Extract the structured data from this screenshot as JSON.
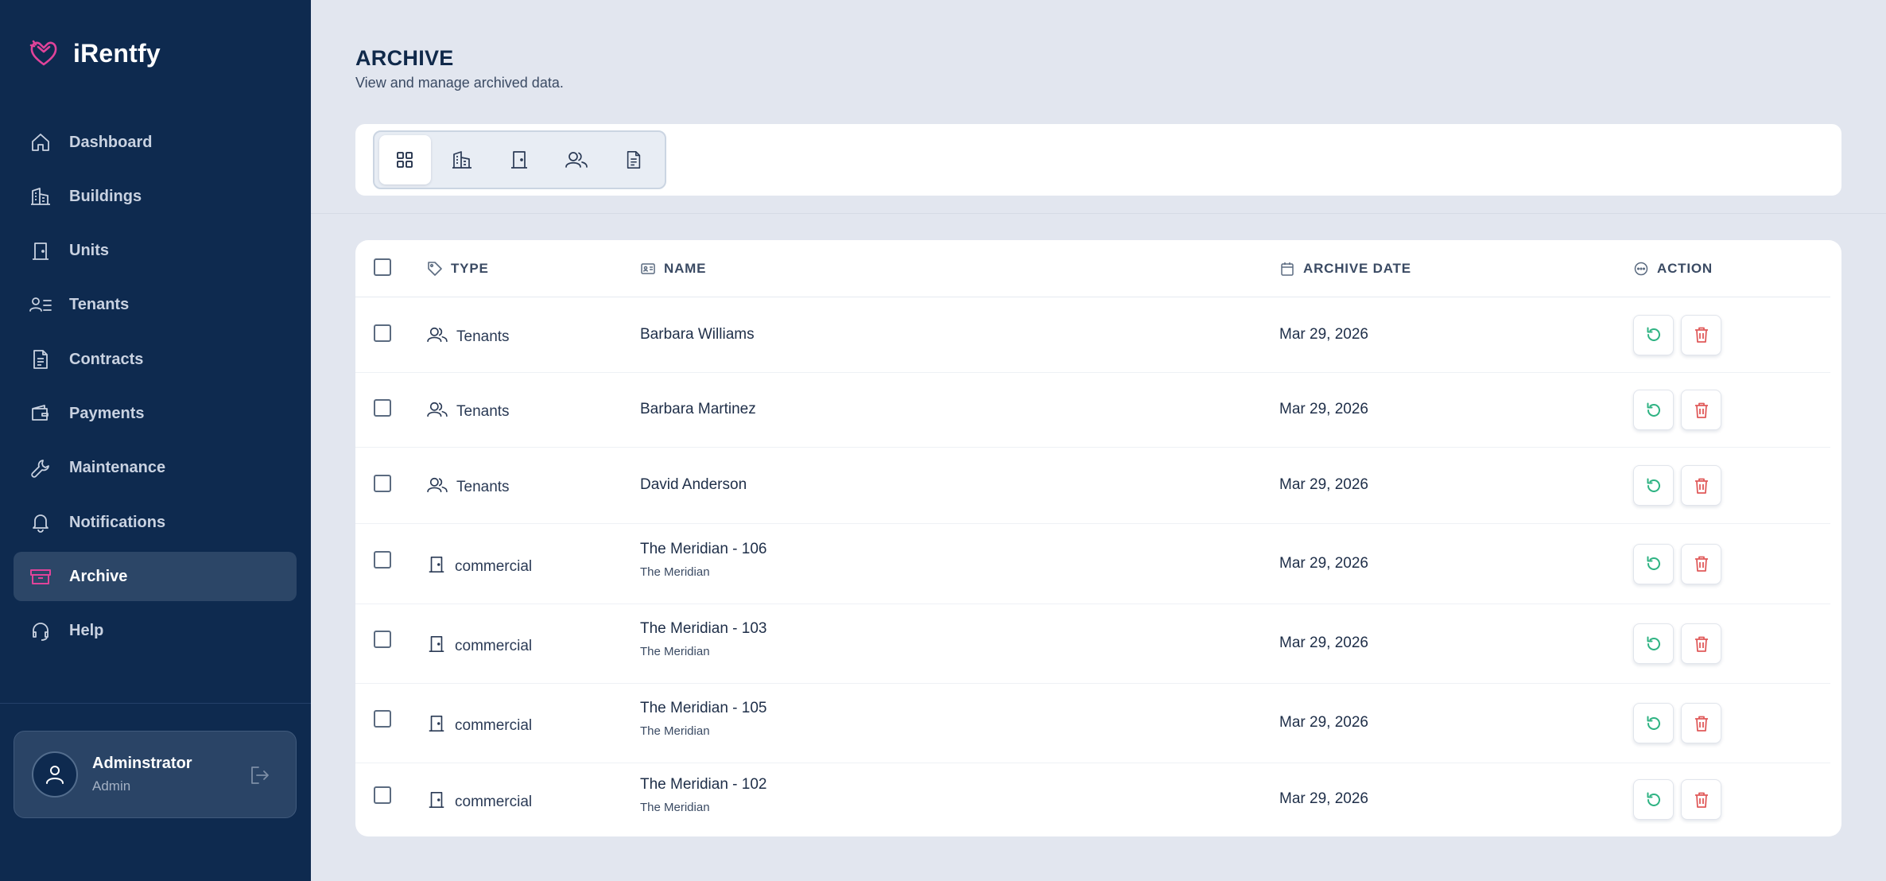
{
  "app": {
    "name": "iRentfy"
  },
  "colors": {
    "sidebar": "#0e2a4f",
    "accent": "#e0439a",
    "restore": "#2fb383",
    "delete": "#e05a5a",
    "background": "#e2e6ef"
  },
  "sidebar": {
    "items": [
      {
        "label": "Dashboard",
        "icon": "home-icon"
      },
      {
        "label": "Buildings",
        "icon": "building-icon"
      },
      {
        "label": "Units",
        "icon": "door-icon"
      },
      {
        "label": "Tenants",
        "icon": "tenants-list-icon"
      },
      {
        "label": "Contracts",
        "icon": "document-icon"
      },
      {
        "label": "Payments",
        "icon": "wallet-icon"
      },
      {
        "label": "Maintenance",
        "icon": "wrench-icon"
      },
      {
        "label": "Notifications",
        "icon": "bell-icon"
      },
      {
        "label": "Archive",
        "icon": "archive-box-icon",
        "active": true
      },
      {
        "label": "Help",
        "icon": "headset-icon"
      }
    ]
  },
  "user": {
    "name": "Adminstrator",
    "role": "Admin"
  },
  "page": {
    "title": "ARCHIVE",
    "subtitle": "View and manage archived data."
  },
  "filters": [
    {
      "icon": "grid-icon",
      "active": true
    },
    {
      "icon": "building-icon",
      "active": false
    },
    {
      "icon": "door-icon",
      "active": false
    },
    {
      "icon": "users-icon",
      "active": false
    },
    {
      "icon": "document-icon",
      "active": false
    }
  ],
  "table": {
    "headers": {
      "type": "TYPE",
      "name": "NAME",
      "archive_date": "ARCHIVE DATE",
      "action": "ACTION"
    },
    "rows": [
      {
        "type": "Tenants",
        "type_icon": "users-icon",
        "name": "Barbara Williams",
        "sub": "",
        "date": "Mar 29, 2026"
      },
      {
        "type": "Tenants",
        "type_icon": "users-icon",
        "name": "Barbara Martinez",
        "sub": "",
        "date": "Mar 29, 2026"
      },
      {
        "type": "Tenants",
        "type_icon": "users-icon",
        "name": "David Anderson",
        "sub": "",
        "date": "Mar 29, 2026"
      },
      {
        "type": "commercial",
        "type_icon": "door-icon",
        "name": "The Meridian - 106",
        "sub": "The Meridian",
        "date": "Mar 29, 2026"
      },
      {
        "type": "commercial",
        "type_icon": "door-icon",
        "name": "The Meridian - 103",
        "sub": "The Meridian",
        "date": "Mar 29, 2026"
      },
      {
        "type": "commercial",
        "type_icon": "door-icon",
        "name": "The Meridian - 105",
        "sub": "The Meridian",
        "date": "Mar 29, 2026"
      },
      {
        "type": "commercial",
        "type_icon": "door-icon",
        "name": "The Meridian - 102",
        "sub": "The Meridian",
        "date": "Mar 29, 2026"
      }
    ]
  }
}
